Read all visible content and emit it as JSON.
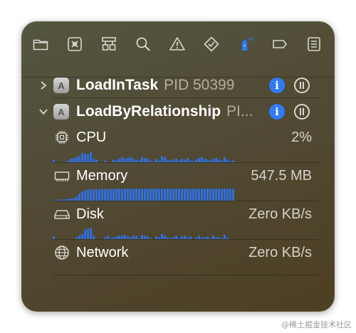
{
  "toolbar": {
    "icons": [
      "folder-icon",
      "breakpoint-navigator-icon",
      "hierarchy-icon",
      "search-icon",
      "warning-icon",
      "test-diamond-icon",
      "debug-spray-icon",
      "tag-icon",
      "report-list-icon"
    ],
    "active_icon": "debug-spray-icon"
  },
  "processes": [
    {
      "name": "LoadInTask",
      "pid": "PID 50399",
      "expanded": false
    },
    {
      "name": "LoadByRelationship",
      "pid": "PI...",
      "expanded": true
    }
  ],
  "metrics": [
    {
      "label": "CPU",
      "value": "2%",
      "icon": "cpu-icon"
    },
    {
      "label": "Memory",
      "value": "547.5 MB",
      "icon": "memory-icon"
    },
    {
      "label": "Disk",
      "value": "Zero KB/s",
      "icon": "disk-icon"
    },
    {
      "label": "Network",
      "value": "Zero KB/s",
      "icon": "globe-icon"
    }
  ],
  "sparklines": {
    "cpu": [
      0.15,
      0,
      0,
      0,
      0,
      0.1,
      0.2,
      0.25,
      0.3,
      0.35,
      0.55,
      0.5,
      0.45,
      0.6,
      0.2,
      0.15,
      0,
      0,
      0.1,
      0,
      0,
      0.15,
      0.1,
      0.2,
      0.3,
      0.2,
      0.25,
      0.3,
      0.2,
      0.15,
      0.1,
      0.3,
      0.25,
      0.2,
      0.1,
      0.05,
      0.2,
      0.1,
      0.35,
      0.3,
      0.15,
      0.1,
      0.15,
      0.2,
      0.1,
      0.2,
      0.15,
      0.25,
      0.1,
      0.05,
      0.15,
      0.25,
      0.3,
      0.2,
      0.15,
      0.1,
      0.2,
      0.25,
      0.15,
      0.1,
      0.3,
      0.15,
      0.05,
      0.1
    ],
    "memory": [
      0.05,
      0.05,
      0.06,
      0.06,
      0.08,
      0.1,
      0.12,
      0.15,
      0.25,
      0.4,
      0.55,
      0.62,
      0.65,
      0.66,
      0.66,
      0.67,
      0.67,
      0.68,
      0.68,
      0.68,
      0.68,
      0.69,
      0.69,
      0.69,
      0.69,
      0.7,
      0.7,
      0.7,
      0.7,
      0.7,
      0.7,
      0.7,
      0.7,
      0.7,
      0.7,
      0.7,
      0.7,
      0.7,
      0.7,
      0.7,
      0.7,
      0.7,
      0.7,
      0.7,
      0.7,
      0.7,
      0.7,
      0.7,
      0.7,
      0.7,
      0.7,
      0.7,
      0.7,
      0.7,
      0.7,
      0.7,
      0.7,
      0.7,
      0.7,
      0.7,
      0.7,
      0.7,
      0.7,
      0.7
    ],
    "disk": [
      0.15,
      0,
      0,
      0,
      0,
      0,
      0,
      0,
      0.1,
      0.2,
      0.3,
      0.55,
      0.6,
      0.65,
      0.2,
      0,
      0,
      0,
      0.1,
      0.2,
      0.05,
      0.1,
      0.15,
      0.2,
      0.2,
      0.25,
      0.15,
      0.1,
      0.2,
      0.2,
      0.05,
      0.25,
      0.2,
      0.15,
      0.05,
      0,
      0.15,
      0.1,
      0.3,
      0.2,
      0.1,
      0.05,
      0.1,
      0.2,
      0.05,
      0.15,
      0.2,
      0.1,
      0.15,
      0,
      0.1,
      0.2,
      0.1,
      0.1,
      0.15,
      0.05,
      0.2,
      0.1,
      0.1,
      0.05,
      0.25,
      0.1,
      0,
      0
    ],
    "color": "#2f6fe0"
  },
  "accent_color": "#2f7bf6",
  "watermark": "@稀土掘金技术社区"
}
